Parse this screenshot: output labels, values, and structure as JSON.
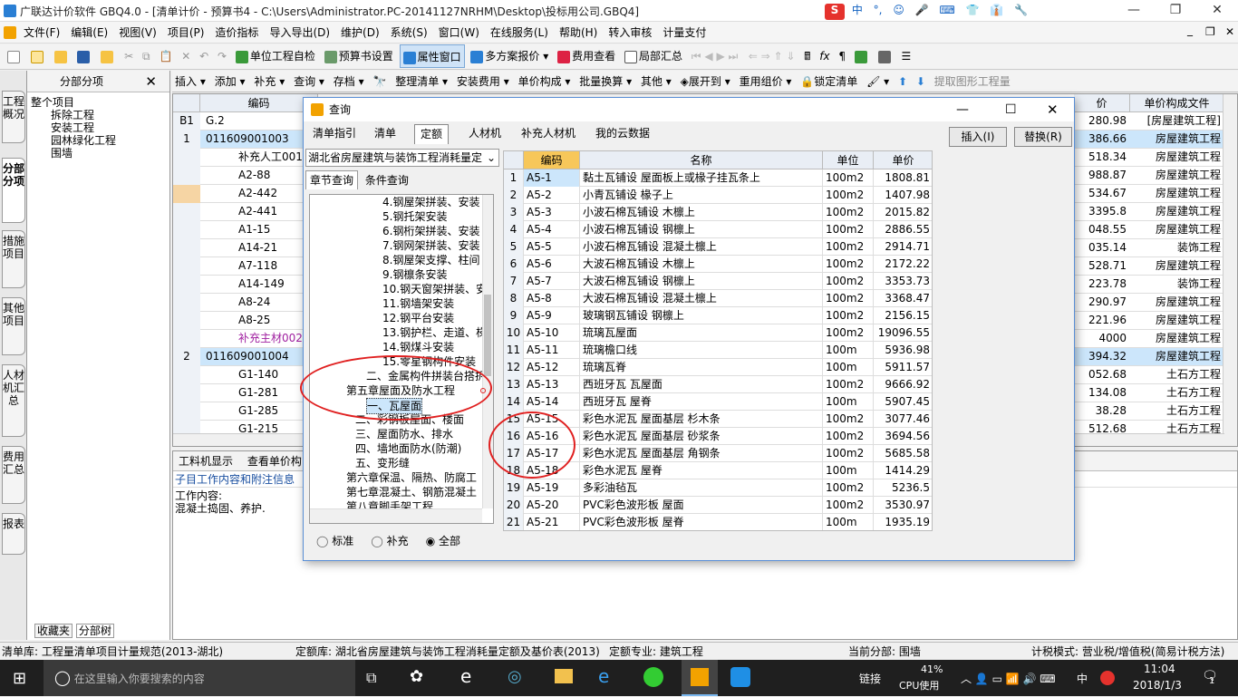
{
  "app": {
    "title": "广联达计价软件 GBQ4.0 - [清单计价 - 预算书4 - C:\\Users\\Administrator.PC-20141127NRHM\\Desktop\\投标用公司.GBQ4]"
  },
  "ime": {
    "items": [
      "中",
      "°,",
      "☺",
      "🎤",
      "⌨",
      "👕",
      "👔",
      "🔧"
    ]
  },
  "window_controls": {
    "min": "—",
    "restore": "❐",
    "close": "✕"
  },
  "menus": [
    "文件(F)",
    "编辑(E)",
    "视图(V)",
    "项目(P)",
    "造价指标",
    "导入导出(D)",
    "维护(D)",
    "系统(S)",
    "窗口(W)",
    "在线服务(L)",
    "帮助(H)",
    "转入审核",
    "计量支付"
  ],
  "toolbar1": {
    "check": "单位工程自检",
    "settings": "预算书设置",
    "props": "属性窗口",
    "multi": "多方案报价",
    "fees": "费用查看",
    "partial": "局部汇总"
  },
  "toolbar2": [
    "插入",
    "添加",
    "补充",
    "查询",
    "存档",
    "整理清单",
    "安装费用",
    "单价构成",
    "批量换算",
    "其他",
    "展开到",
    "重用组价",
    "锁定清单",
    "提取图形工程量"
  ],
  "left": {
    "header": "分部分项",
    "tree": [
      "整个项目",
      "拆除工程",
      "安装工程",
      "园林绿化工程",
      "围墙"
    ],
    "tabs_bottom": [
      "收藏夹",
      "分部树"
    ]
  },
  "side_tabs": [
    "工程概况",
    "分部分项",
    "措施项目",
    "其他项目",
    "人材机汇总",
    "费用汇总",
    "报表"
  ],
  "grid": {
    "h_code": "编码",
    "h_price": "价",
    "h_file": "单价构成文件",
    "rows": [
      {
        "n": "B1",
        "code": "G.2",
        "price": "280.98",
        "file": "[房屋建筑工程]",
        "sel": false
      },
      {
        "n": "1",
        "code": "011609001003",
        "price": "386.66",
        "file": "房屋建筑工程",
        "sel": true
      },
      {
        "n": "",
        "code": "补充人工001@",
        "price": "518.34",
        "file": "房屋建筑工程",
        "sel": false
      },
      {
        "n": "",
        "code": "A2-88",
        "price": "988.87",
        "file": "房屋建筑工程",
        "sel": false
      },
      {
        "n": "",
        "code": "A2-442",
        "price": "534.67",
        "file": "房屋建筑工程",
        "sel": false
      },
      {
        "n": "",
        "code": "A2-441",
        "price": "3395.8",
        "file": "房屋建筑工程",
        "sel": false
      },
      {
        "n": "",
        "code": "A1-15",
        "price": "048.55",
        "file": "房屋建筑工程",
        "sel": false
      },
      {
        "n": "",
        "code": "A14-21",
        "price": "035.14",
        "file": "装饰工程",
        "sel": false
      },
      {
        "n": "",
        "code": "A7-118",
        "price": "528.71",
        "file": "房屋建筑工程",
        "sel": false
      },
      {
        "n": "",
        "code": "A14-149",
        "price": "223.78",
        "file": "装饰工程",
        "sel": false
      },
      {
        "n": "",
        "code": "A8-24",
        "price": "290.97",
        "file": "房屋建筑工程",
        "sel": false
      },
      {
        "n": "",
        "code": "A8-25",
        "price": "221.96",
        "file": "房屋建筑工程",
        "sel": false
      },
      {
        "n": "",
        "code": "补充主材002",
        "price": "4000",
        "file": "房屋建筑工程",
        "sel": false
      },
      {
        "n": "2",
        "code": "011609001004",
        "price": "394.32",
        "file": "房屋建筑工程",
        "sel": true
      },
      {
        "n": "",
        "code": "G1-140",
        "price": "052.68",
        "file": "土石方工程",
        "sel": false
      },
      {
        "n": "",
        "code": "G1-281",
        "price": "134.08",
        "file": "土石方工程",
        "sel": false
      },
      {
        "n": "",
        "code": "G1-285",
        "price": "38.28",
        "file": "土石方工程",
        "sel": false
      },
      {
        "n": "",
        "code": "G1-215",
        "price": "512.68",
        "file": "土石方工程",
        "sel": false
      }
    ]
  },
  "bottom": {
    "tab1": "工料机显示",
    "tab2": "查看单价构",
    "section": "子目工作内容和附注信息",
    "content_label": "工作内容:",
    "content": "混凝土捣固、养护."
  },
  "status": {
    "list": "清单库: 工程量清单项目计量规范(2013-湖北)",
    "quota": "定额库: 湖北省房屋建筑与装饰工程消耗量定额及基价表(2013)",
    "major": "定额专业: 建筑工程",
    "part": "当前分部: 围墙",
    "tax": "计税模式: 营业税/增值税(简易计税方法)"
  },
  "dialog": {
    "title": "查询",
    "tabs": [
      "清单指引",
      "清单",
      "定额",
      "人材机",
      "补充人材机",
      "我的云数据"
    ],
    "active_tab": "定额",
    "insert": "插入(I)",
    "replace": "替换(R)",
    "lib": "湖北省房屋建筑与装饰工程消耗量定",
    "subtabs": [
      "章节查询",
      "条件查询"
    ],
    "tree": [
      "4.钢屋架拼装、安装",
      "5.钢托架安装",
      "6.钢桁架拼装、安装",
      "7.钢网架拼装、安装",
      "8.钢屋架支撑、柱间",
      "9.钢檩条安装",
      "10.钢天窗架拼装、安",
      "11.钢墙架安装",
      "12.钢平台安装",
      "13.钢护栏、走道、梯",
      "14.钢煤斗安装",
      "15.零星钢构件安装",
      "二、金属构件拼装台搭拆",
      "第五章屋面及防水工程",
      "一、瓦屋面",
      "二、彩钢板屋面、楼面",
      "三、屋面防水、排水",
      "四、墙地面防水(防潮)",
      "五、变形缝",
      "第六章保温、隔热、防腐工",
      "第七章混凝土、钢筋混凝土",
      "第八章脚手架工程"
    ],
    "radios": [
      "标准",
      "补充",
      "全部"
    ],
    "cols": {
      "code": "编码",
      "name": "名称",
      "unit": "单位",
      "price": "单价"
    },
    "rows": [
      [
        "1",
        "A5-1",
        "黏土瓦铺设 屋面板上或椽子挂瓦条上",
        "100m2",
        "1808.81"
      ],
      [
        "2",
        "A5-2",
        "小青瓦铺设 椽子上",
        "100m2",
        "1407.98"
      ],
      [
        "3",
        "A5-3",
        "小波石棉瓦铺设 木檩上",
        "100m2",
        "2015.82"
      ],
      [
        "4",
        "A5-4",
        "小波石棉瓦铺设 钢檩上",
        "100m2",
        "2886.55"
      ],
      [
        "5",
        "A5-5",
        "小波石棉瓦铺设 混凝土檩上",
        "100m2",
        "2914.71"
      ],
      [
        "6",
        "A5-6",
        "大波石棉瓦铺设 木檩上",
        "100m2",
        "2172.22"
      ],
      [
        "7",
        "A5-7",
        "大波石棉瓦铺设 钢檩上",
        "100m2",
        "3353.73"
      ],
      [
        "8",
        "A5-8",
        "大波石棉瓦铺设 混凝土檩上",
        "100m2",
        "3368.47"
      ],
      [
        "9",
        "A5-9",
        "玻璃钢瓦铺设 钢檩上",
        "100m2",
        "2156.15"
      ],
      [
        "10",
        "A5-10",
        "琉璃瓦屋面",
        "100m2",
        "19096.55"
      ],
      [
        "11",
        "A5-11",
        "琉璃檐口线",
        "100m",
        "5936.98"
      ],
      [
        "12",
        "A5-12",
        "琉璃瓦脊",
        "100m",
        "5911.57"
      ],
      [
        "13",
        "A5-13",
        "西班牙瓦 瓦屋面",
        "100m2",
        "9666.92"
      ],
      [
        "14",
        "A5-14",
        "西班牙瓦 屋脊",
        "100m",
        "5907.45"
      ],
      [
        "15",
        "A5-15",
        "彩色水泥瓦 屋面基层 杉木条",
        "100m2",
        "3077.46"
      ],
      [
        "16",
        "A5-16",
        "彩色水泥瓦 屋面基层 砂浆条",
        "100m2",
        "3694.56"
      ],
      [
        "17",
        "A5-17",
        "彩色水泥瓦 屋面基层 角钢条",
        "100m2",
        "5685.58"
      ],
      [
        "18",
        "A5-18",
        "彩色水泥瓦 屋脊",
        "100m",
        "1414.29"
      ],
      [
        "19",
        "A5-19",
        "多彩油毡瓦",
        "100m2",
        "5236.5"
      ],
      [
        "20",
        "A5-20",
        "PVC彩色波形板 屋面",
        "100m2",
        "3530.97"
      ],
      [
        "21",
        "A5-21",
        "PVC彩色波形板 屋脊",
        "100m",
        "1935.19"
      ]
    ]
  },
  "taskbar": {
    "search": "在这里输入你要搜索的内容",
    "link": "链接",
    "cpu_pct": "41%",
    "cpu_label": "CPU使用",
    "lang": "中",
    "time": "11:04",
    "date": "2018/1/3",
    "notif": "1"
  },
  "colors": {
    "accent": "#0078d7",
    "select": "#cce6fb",
    "red": "#e02020"
  }
}
